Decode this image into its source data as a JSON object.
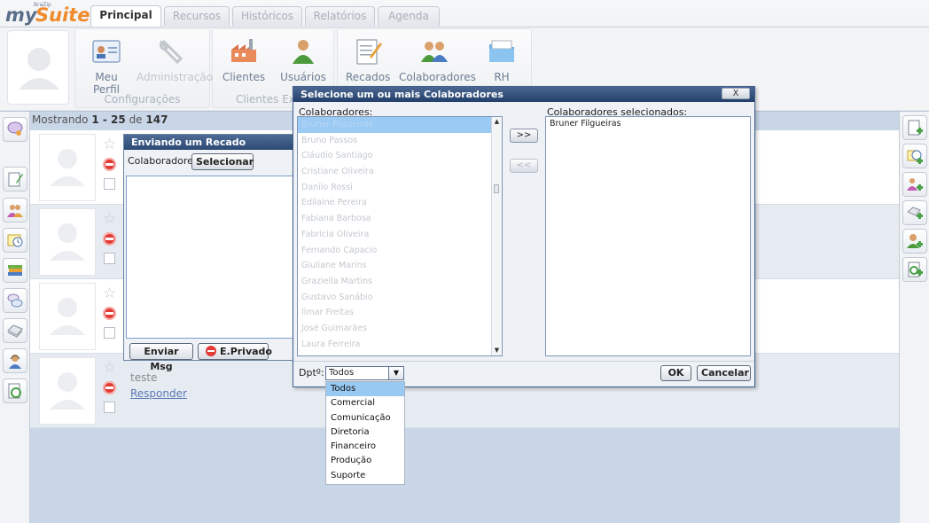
{
  "logo": {
    "by": "BraZip",
    "my": "my",
    "suite": "Suite"
  },
  "tabs": [
    {
      "label": "Principal",
      "active": true
    },
    {
      "label": "Recursos"
    },
    {
      "label": "Históricos"
    },
    {
      "label": "Relatórios"
    },
    {
      "label": "Agenda"
    }
  ],
  "ribbon": {
    "groups": {
      "configuracoes": "Configurações",
      "clientes": "Clientes Exte"
    },
    "buttons": {
      "meu_perfil": "Meu Perfil",
      "administracao": "Administração",
      "clientes": "Clientes",
      "usuarios": "Usuários",
      "recados": "Recados",
      "colaboradores": "Colaboradores",
      "rh": "RH"
    }
  },
  "list": {
    "showing_prefix": "Mostrando",
    "showing_range": "1 - 25",
    "showing_of": "de",
    "showing_total": "147",
    "row4_text": "teste",
    "row4_link": "Responder"
  },
  "recado": {
    "title": "Enviando um Recado",
    "colaboradores_label": "Colaboradores:",
    "selecionar": "Selecionar",
    "enviar": "Enviar Msg",
    "privado": "E.Privado"
  },
  "dialog": {
    "title": "Selecione um ou mais Colaboradores",
    "close": "X",
    "left_label": "Colaboradores:",
    "right_label": "Colaboradores selecionados:",
    "add": ">>",
    "remove": "<<",
    "available": [
      "Bruner Filgueiras",
      "Bruno Passos",
      "Cláudio Santiago",
      "Cristiane Oliveira",
      "Danilo Rossi",
      "Edilaine Pereira",
      "Fabiana Barbosa",
      "Fabrícia Oliveira",
      "Fernando Capacio",
      "Giuliane Marins",
      "Graziella Martins",
      "Gustavo Sanábio",
      "Ilmar Freitas",
      "José Guimarães",
      "Laura Ferreira"
    ],
    "selected": [
      "Bruner Filgueiras"
    ],
    "dpto_label": "Dptº:",
    "dpto_value": "Todos",
    "ok": "OK",
    "cancel": "Cancelar"
  },
  "dropdown": {
    "options": [
      "Todos",
      "Comercial",
      "Comunicação",
      "Diretoria",
      "Financeiro",
      "Produção",
      "Suporte"
    ]
  },
  "colors": {
    "title_bar": "#2c4a74",
    "selection": "#9bcaf4",
    "logo_orange": "#f08a2a",
    "logo_blue": "#5a6e8a",
    "danger": "#e23a35"
  }
}
